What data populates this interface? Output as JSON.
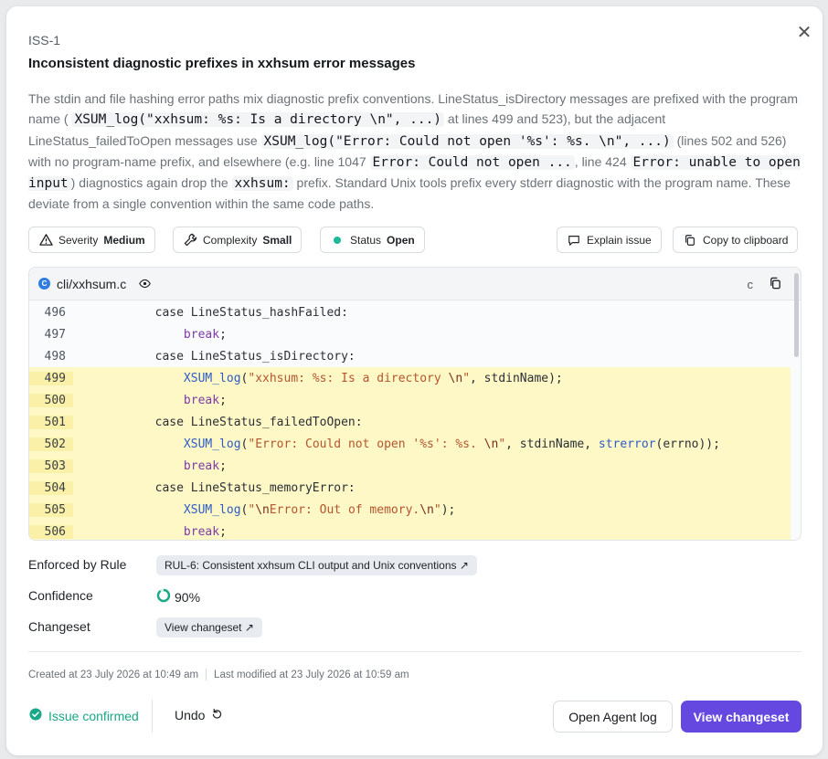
{
  "issue": {
    "id": "ISS-1",
    "title": "Inconsistent diagnostic prefixes in xxhsum error messages",
    "description": {
      "t1": "The stdin and file hashing error paths mix diagnostic prefix conventions. LineStatus_isDirectory messages are prefixed with the program name ( ",
      "c1": "XSUM_log(\"xxhsum: %s: Is a directory \\n\", ...)",
      "t2": " at lines 499 and 523), but the adjacent LineStatus_failedToOpen messages use ",
      "c2": "XSUM_log(\"Error: Could not open '%s': %s. \\n\", ...)",
      "t3": " (lines 502 and 526) with no program-name prefix, and elsewhere (e.g. line 1047 ",
      "c3": "Error: Could not open ...",
      "t4": ", line 424 ",
      "c4": "Error: unable to open input",
      "t5": ") diagnostics again drop the ",
      "c5": "xxhsum:",
      "t6": " prefix. Standard Unix tools prefix every stderr diagnostic with the program name. These deviate from a single convention within the same code paths."
    }
  },
  "chips": {
    "severity_label": "Severity",
    "severity_value": "Medium",
    "complexity_label": "Complexity",
    "complexity_value": "Small",
    "status_label": "Status",
    "status_value": "Open"
  },
  "actions": {
    "explain": "Explain issue",
    "copy": "Copy to clipboard"
  },
  "code": {
    "file": "cli/xxhsum.c",
    "file_badge": "C",
    "language": "c"
  },
  "meta": {
    "rule_label": "Enforced by Rule",
    "rule_value": "RUL-6: Consistent xxhsum CLI output and Unix conventions ↗",
    "confidence_label": "Confidence",
    "confidence_value": "90%",
    "confidence_fraction": 0.9,
    "changeset_label": "Changeset",
    "changeset_value": "View changeset ↗"
  },
  "timestamps": {
    "created": "Created at 23 July 2026 at 10:49 am",
    "modified": "Last modified at 23 July 2026 at 10:59 am"
  },
  "footer": {
    "confirmed": "Issue confirmed",
    "undo": "Undo",
    "agent_log": "Open Agent log",
    "view_changeset": "View changeset"
  },
  "colors": {
    "accent": "#6548e0",
    "success": "#1aa888",
    "highlight": "#fdf8c6"
  }
}
